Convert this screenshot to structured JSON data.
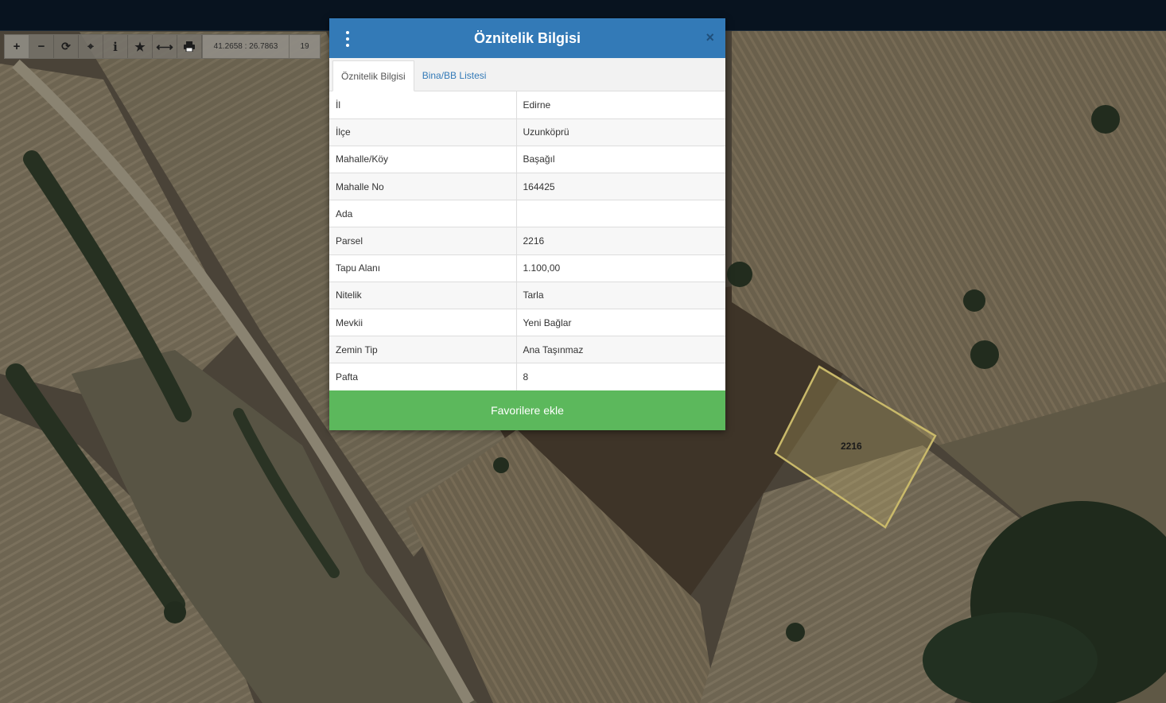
{
  "toolbar": {
    "coords": "41.2658 : 26.7863",
    "zoom": "19"
  },
  "dialog": {
    "title": "Öznitelik Bilgisi",
    "close": "×",
    "tabs": [
      {
        "label": "Öznitelik Bilgisi",
        "active": true
      },
      {
        "label": "Bina/BB Listesi",
        "active": false
      }
    ],
    "rows": [
      {
        "key": "İl",
        "value": "Edirne"
      },
      {
        "key": "İlçe",
        "value": "Uzunköprü"
      },
      {
        "key": "Mahalle/Köy",
        "value": "Başağıl"
      },
      {
        "key": "Mahalle No",
        "value": "164425"
      },
      {
        "key": "Ada",
        "value": ""
      },
      {
        "key": "Parsel",
        "value": "2216"
      },
      {
        "key": "Tapu Alanı",
        "value": "1.100,00"
      },
      {
        "key": "Nitelik",
        "value": "Tarla"
      },
      {
        "key": "Mevkii",
        "value": "Yeni Bağlar"
      },
      {
        "key": "Zemin Tip",
        "value": "Ana Taşınmaz"
      },
      {
        "key": "Pafta",
        "value": "8"
      }
    ],
    "favorite_button": "Favorilere ekle"
  },
  "map": {
    "parcel_label": "2216"
  },
  "colors": {
    "header": "#337ab7",
    "favorite": "#5cb85c",
    "parcel_outline": "#c9b96a"
  }
}
